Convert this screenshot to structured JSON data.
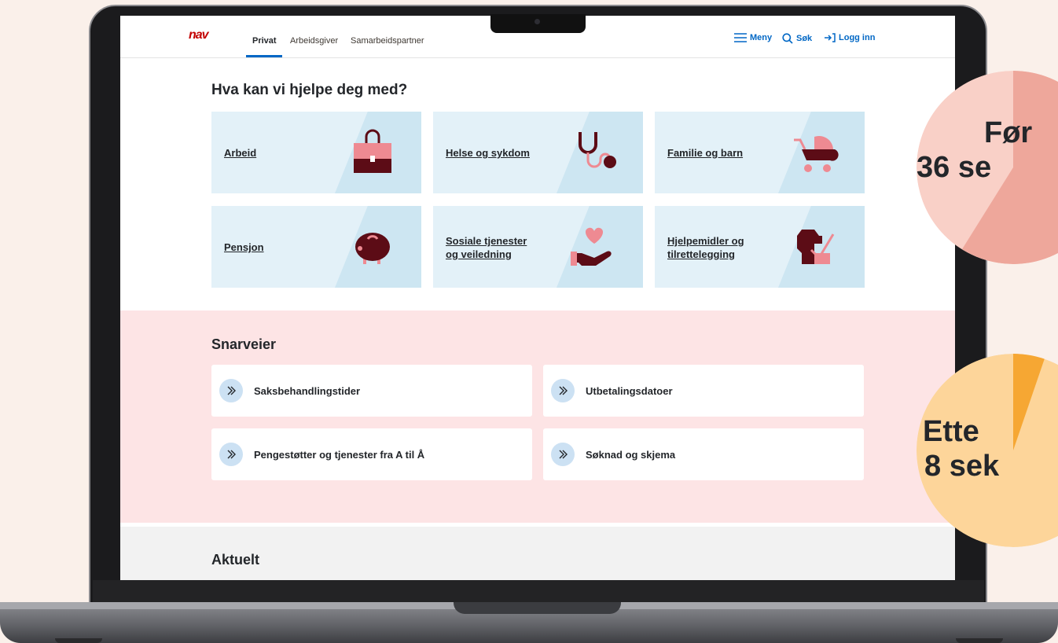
{
  "header": {
    "logo": "nav",
    "tabs": [
      "Privat",
      "Arbeidsgiver",
      "Samarbeidspartner"
    ],
    "actions": {
      "menu": "Meny",
      "search": "Søk",
      "login": "Logg inn"
    }
  },
  "help": {
    "title": "Hva kan vi hjelpe deg med?",
    "cards": [
      {
        "label1": "Arbeid",
        "label2": "",
        "icon": "briefcase-icon"
      },
      {
        "label1": "Helse og sykdom",
        "label2": "",
        "icon": "stethoscope-icon"
      },
      {
        "label1": "Familie og barn",
        "label2": "",
        "icon": "stroller-icon"
      },
      {
        "label1": "Pensjon",
        "label2": "",
        "icon": "piggy-bank-icon"
      },
      {
        "label1": "Sosiale tjenester",
        "label2": "og veiledning",
        "icon": "hand-heart-icon"
      },
      {
        "label1": "Hjelpemidler og",
        "label2": "tilrettelegging",
        "icon": "guide-dog-icon"
      }
    ]
  },
  "shortcuts": {
    "title": "Snarveier",
    "items": [
      "Saksbehandlingstider",
      "Utbetalingsdatoer",
      "Pengestøtter og tjenester fra A til Å",
      "Søknad og skjema"
    ]
  },
  "news": {
    "title": "Aktuelt"
  },
  "comparison": {
    "before": {
      "line1": "Før",
      "line2": "36 se"
    },
    "after": {
      "line1": "Ette",
      "line2": "8 sek"
    }
  },
  "colors": {
    "accent": "#0067c5",
    "brand": "#c30000",
    "pink": "#fde4e5",
    "card": "#e3f1f8"
  }
}
